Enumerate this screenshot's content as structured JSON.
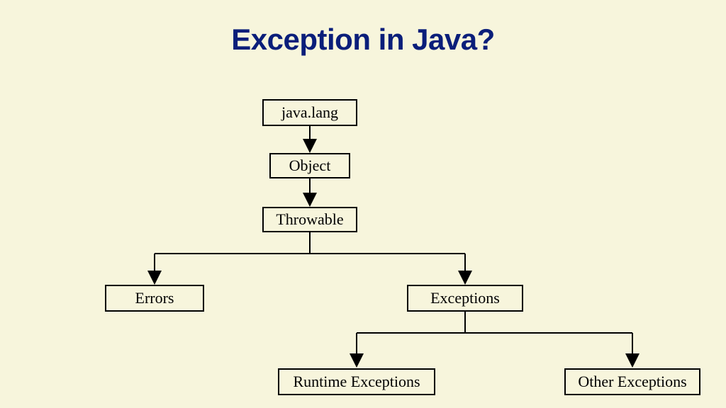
{
  "title": "Exception in Java?",
  "nodes": {
    "javalang": "java.lang",
    "object": "Object",
    "throwable": "Throwable",
    "errors": "Errors",
    "exceptions": "Exceptions",
    "runtime": "Runtime Exceptions",
    "other": "Other Exceptions"
  },
  "hierarchy": {
    "root": "java.lang",
    "children": [
      {
        "name": "Object",
        "children": [
          {
            "name": "Throwable",
            "children": [
              {
                "name": "Errors"
              },
              {
                "name": "Exceptions",
                "children": [
                  {
                    "name": "Runtime Exceptions"
                  },
                  {
                    "name": "Other Exceptions"
                  }
                ]
              }
            ]
          }
        ]
      }
    ]
  }
}
